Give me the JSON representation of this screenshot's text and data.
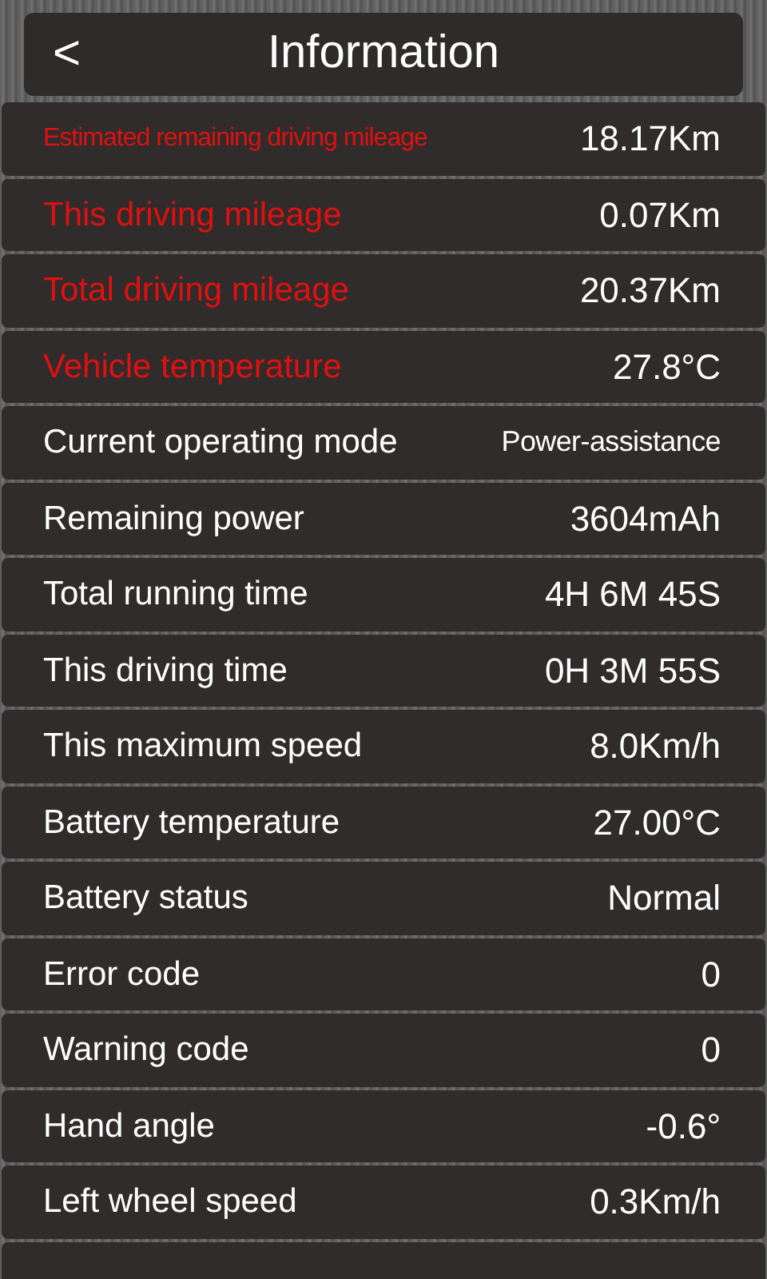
{
  "header": {
    "back": "<",
    "title": "Information"
  },
  "rows": [
    {
      "label": "Estimated remaining driving mileage",
      "value": "18.17Km",
      "highlighted": true
    },
    {
      "label": "This driving mileage",
      "value": "0.07Km",
      "highlighted": true
    },
    {
      "label": "Total driving mileage",
      "value": "20.37Km",
      "highlighted": true
    },
    {
      "label": "Vehicle temperature",
      "value": "27.8°C",
      "highlighted": true
    },
    {
      "label": "Current operating mode",
      "value": "Power-assistance",
      "highlighted": false
    },
    {
      "label": "Remaining power",
      "value": "3604mAh",
      "highlighted": false
    },
    {
      "label": "Total running time",
      "value": "4H 6M 45S",
      "highlighted": false
    },
    {
      "label": "This driving time",
      "value": "0H 3M 55S",
      "highlighted": false
    },
    {
      "label": "This maximum speed",
      "value": "8.0Km/h",
      "highlighted": false
    },
    {
      "label": "Battery temperature",
      "value": "27.00°C",
      "highlighted": false
    },
    {
      "label": "Battery status",
      "value": "Normal",
      "highlighted": false
    },
    {
      "label": "Error code",
      "value": "0",
      "highlighted": false
    },
    {
      "label": "Warning code",
      "value": "0",
      "highlighted": false
    },
    {
      "label": "Hand angle",
      "value": "-0.6°",
      "highlighted": false
    },
    {
      "label": "Left wheel speed",
      "value": "0.3Km/h",
      "highlighted": false
    }
  ]
}
